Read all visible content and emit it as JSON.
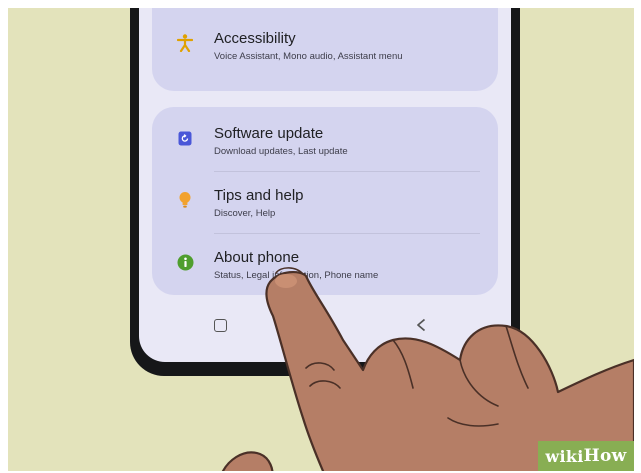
{
  "settings": {
    "accessibility": {
      "title": "Accessibility",
      "subtitle": "Voice Assistant, Mono audio, Assistant menu",
      "icon": "accessibility-icon",
      "color": "#e0a100"
    },
    "software_update": {
      "title": "Software update",
      "subtitle": "Download updates, Last update",
      "icon": "software-update-icon",
      "color": "#4a57d8"
    },
    "tips_and_help": {
      "title": "Tips and help",
      "subtitle": "Discover, Help",
      "icon": "lightbulb-icon",
      "color": "#f2a22e"
    },
    "about_phone": {
      "title": "About phone",
      "subtitle": "Status, Legal information, Phone name",
      "icon": "info-icon",
      "color": "#4f9e2e"
    }
  },
  "navbar": {
    "buttons": [
      "recent-apps-icon",
      "back-icon"
    ]
  },
  "watermark": {
    "wiki": "wiki",
    "how": "How"
  }
}
